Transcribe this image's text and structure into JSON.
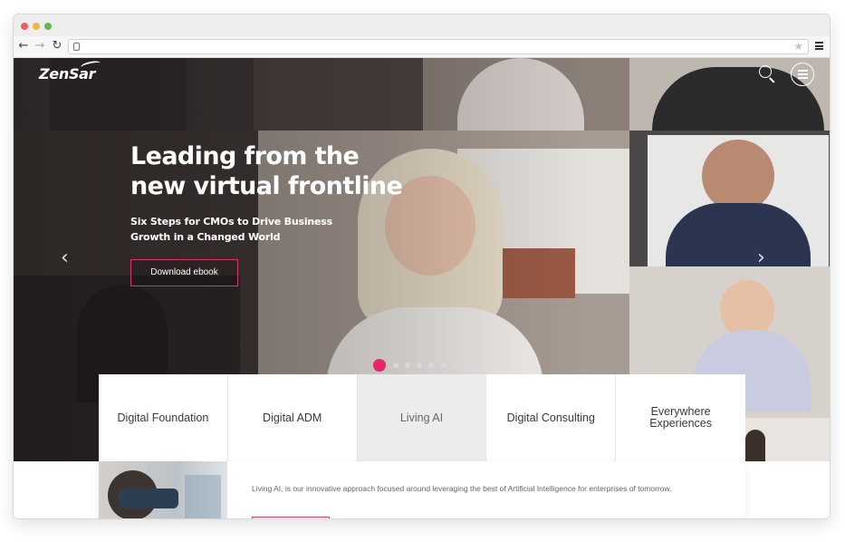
{
  "browser": {
    "url": "",
    "back_icon": "arrow-left-icon",
    "forward_icon": "arrow-right-icon",
    "reload_icon": "reload-icon",
    "lock_icon": "lock-icon",
    "bookmark_icon": "star-icon",
    "menu_icon": "menu-icon"
  },
  "header": {
    "logo_text": "ZenSar",
    "search_icon": "search-icon",
    "menu_icon": "hamburger-icon"
  },
  "hero": {
    "title": "Leading from the new virtual frontline",
    "subtitle": "Six Steps for CMOs to Drive Business Growth in a Changed World",
    "cta_label": "Download ebook",
    "prev_arrow": "‹",
    "next_arrow": "›",
    "slide_count": 8,
    "active_slide": 1
  },
  "tabs": [
    {
      "label": "Digital Foundation",
      "selected": false
    },
    {
      "label": "Digital ADM",
      "selected": false
    },
    {
      "label": "Living AI",
      "selected": true
    },
    {
      "label": "Digital Consulting",
      "selected": false
    },
    {
      "label": "Everywhere Experiences",
      "selected": false
    }
  ],
  "promo": {
    "text": "Living AI, is our innovative approach focused around leveraging the best of Artificial Intelligence for enterprises of tomorrow."
  },
  "colors": {
    "accent": "#e5246b",
    "hero_dark": "#2b2726",
    "tab_selected_bg": "#ececec"
  }
}
